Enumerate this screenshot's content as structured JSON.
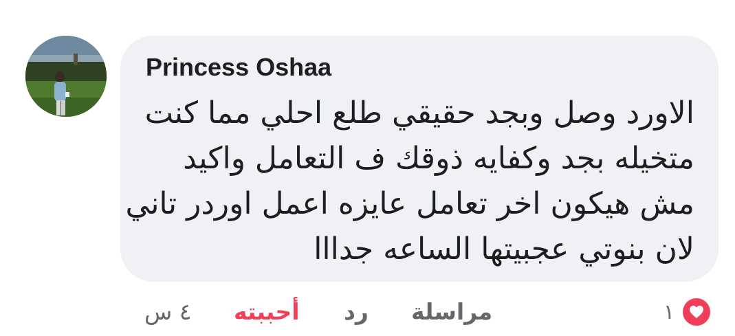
{
  "comment": {
    "author": "Princess Oshaa",
    "lines": [
      "الاورد وصل وبجد حقيقي طلع احلي مما كنت",
      "متخيله بجد وكفايه ذوقك ف التعامل واكيد",
      "مش هيكون اخر تعامل عايزه اعمل اوردر تاني",
      "لان بنوتي عجبيتها الساعه جدااا"
    ]
  },
  "actions": {
    "time": "٤ س",
    "like": "أحببته",
    "reply": "رد",
    "message": "مراسلة"
  },
  "reactions": {
    "count": "١",
    "icon": "heart-icon",
    "color": "#f03e5a"
  }
}
